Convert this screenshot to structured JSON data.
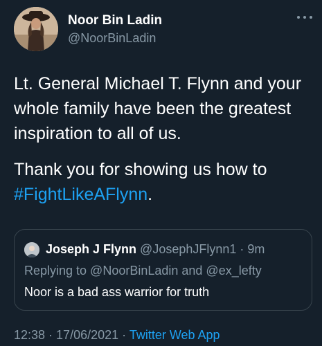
{
  "author": {
    "display_name": "Noor Bin Ladin",
    "handle": "@NoorBinLadin"
  },
  "tweet": {
    "paragraph_1": "Lt. General Michael T. Flynn and your whole family have been the greatest inspiration to all of us.",
    "paragraph_2_text": "Thank you for showing us how to ",
    "paragraph_2_hashtag": "#FightLikeAFlynn",
    "paragraph_2_end": "."
  },
  "quoted_tweet": {
    "display_name": "Joseph J Flynn",
    "handle": "@JosephJFlynn1",
    "separator": " · ",
    "time": "9m",
    "replying_to": "Replying to @NoorBinLadin and @ex_lefty",
    "text": "Noor is a bad ass warrior for truth"
  },
  "footer": {
    "time": "12:38",
    "separator_1": " · ",
    "date": "17/06/2021",
    "separator_2": " · ",
    "source": "Twitter Web App"
  },
  "icons": {
    "more": "more-horizontal-icon"
  },
  "colors": {
    "background": "#15202b",
    "text_primary": "#ffffff",
    "text_secondary": "#8899a6",
    "link": "#1da1f2",
    "border": "#38444d"
  }
}
